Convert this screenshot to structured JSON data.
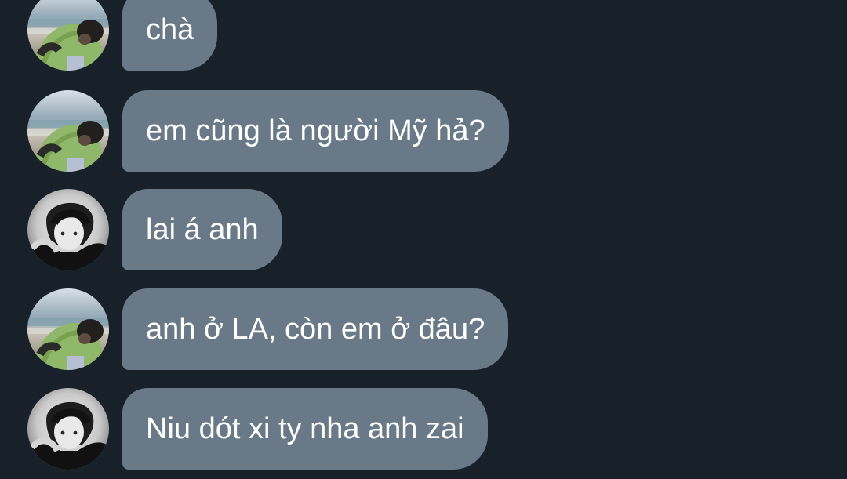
{
  "messages": [
    {
      "sender": "beach-avatar",
      "text": "chà"
    },
    {
      "sender": "beach-avatar",
      "text": "em cũng là người Mỹ hả?"
    },
    {
      "sender": "portrait-avatar",
      "text": "lai á anh"
    },
    {
      "sender": "beach-avatar",
      "text": "anh ở LA, còn em ở đâu?"
    },
    {
      "sender": "portrait-avatar",
      "text": "Niu dót xi ty nha anh zai"
    }
  ],
  "colors": {
    "background": "#18202a",
    "bubble": "#6a7987",
    "text": "#ffffff"
  }
}
